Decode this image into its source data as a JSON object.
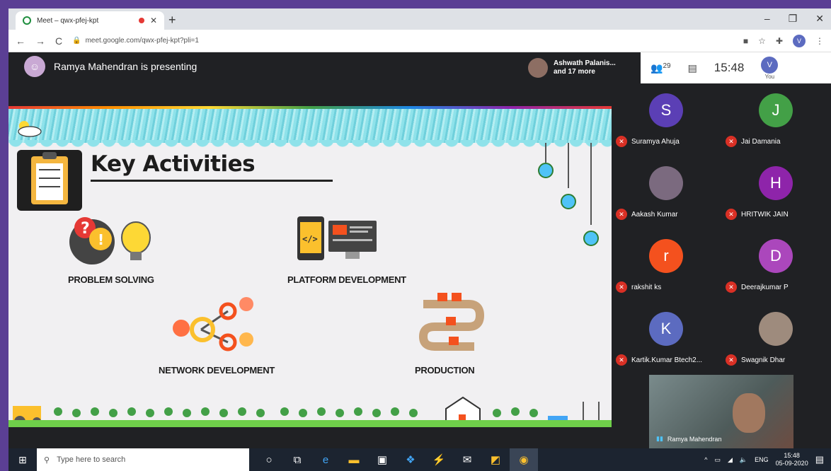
{
  "browser": {
    "tab_title": "Meet – qwx-pfej-kpt",
    "url": "meet.google.com/qwx-pfej-kpt?pli=1",
    "profile_initial": "V"
  },
  "meet": {
    "presenter_text": "Ramya Mahendran is presenting",
    "people_chip_line1": "Ashwath Palanis...",
    "people_chip_line2": "and 17 more",
    "participant_count": "29",
    "clock": "15:48",
    "you_label": "You",
    "you_initial": "V",
    "participants": [
      {
        "initial": "S",
        "name": "Suramya Ahuja",
        "color": "#5b3fb5"
      },
      {
        "initial": "J",
        "name": "Jai Damania",
        "color": "#43a047"
      },
      {
        "initial": "",
        "name": "Aakash Kumar",
        "color": "#7b6a7f"
      },
      {
        "initial": "H",
        "name": "HRITWIK JAIN",
        "color": "#8e24aa"
      },
      {
        "initial": "r",
        "name": "rakshit ks",
        "color": "#f4511e"
      },
      {
        "initial": "D",
        "name": "Deerajkumar P",
        "color": "#ab47bc"
      },
      {
        "initial": "K",
        "name": "Kartik.Kumar Btech2...",
        "color": "#5c6bc0"
      },
      {
        "initial": "",
        "name": "Swagnik Dhar",
        "color": "#9e8b7d"
      }
    ],
    "self_name": "Ramya Mahendran"
  },
  "slide": {
    "title": "Key Activities",
    "activities": [
      "PROBLEM SOLVING",
      "PLATFORM DEVELOPMENT",
      "NETWORK DEVELOPMENT",
      "PRODUCTION"
    ]
  },
  "taskbar": {
    "search_placeholder": "Type here to search",
    "lang": "ENG",
    "time": "15:48",
    "date": "05-09-2020"
  }
}
